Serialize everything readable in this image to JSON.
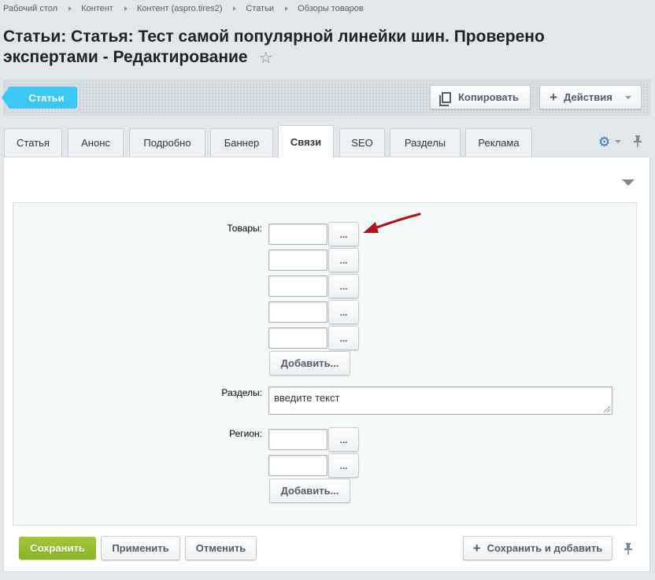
{
  "breadcrumb": [
    "Рабочий стол",
    "Контент",
    "Контент (aspro.tires2)",
    "Статьи",
    "Обзоры товаров"
  ],
  "title": "Статьи: Статья: Тест самой популярной линейки шин. Проверено экспертами - Редактирование",
  "icons": {
    "star": "star-icon",
    "copy": "copy-icon",
    "plus": "plus-icon",
    "gear": "gear-icon",
    "pin": "pin-icon",
    "collapse": "triangle-down-icon",
    "arrow": "red-arrow"
  },
  "toolbar": {
    "back_label": "Статьи",
    "copy_label": "Копировать",
    "actions_label": "Действия"
  },
  "tabs": [
    {
      "label": "Статья",
      "active": false
    },
    {
      "label": "Анонс",
      "active": false
    },
    {
      "label": "Подробно",
      "active": false
    },
    {
      "label": "Баннер",
      "active": false
    },
    {
      "label": "Связи",
      "active": true
    },
    {
      "label": "SEO",
      "active": false
    },
    {
      "label": "Разделы",
      "active": false
    },
    {
      "label": "Реклама",
      "active": false
    }
  ],
  "form": {
    "products_label": "Товары:",
    "products_inputs": [
      "",
      "",
      "",
      "",
      ""
    ],
    "dots_label": "...",
    "add_label": "Добавить...",
    "sections_label": "Разделы:",
    "sections_placeholder": "введите текст",
    "region_label": "Регион:",
    "region_inputs": [
      "",
      ""
    ]
  },
  "footer": {
    "save_label": "Сохранить",
    "apply_label": "Применить",
    "cancel_label": "Отменить",
    "save_add_label": "Сохранить и добавить"
  },
  "colors": {
    "accent_blue": "#3bc8f5",
    "save_green": "#8ab628",
    "arrow_red": "#b1151b",
    "gear_blue": "#2f74c2"
  }
}
